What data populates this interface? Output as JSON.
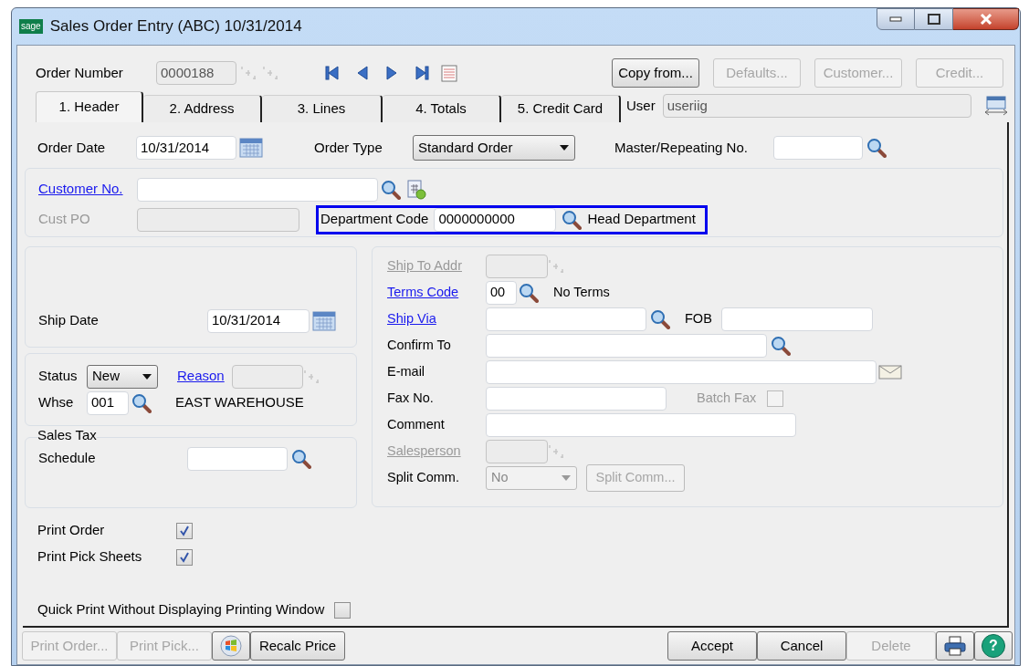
{
  "window": {
    "title": "Sales Order Entry (ABC) 10/31/2014",
    "logo": "sage"
  },
  "order_number": {
    "label": "Order Number",
    "value": "0000188",
    "disabled": true
  },
  "top_buttons": [
    {
      "label": "Copy from...",
      "disabled": false
    },
    {
      "label": "Defaults...",
      "disabled": true
    },
    {
      "label": "Customer...",
      "disabled": true
    },
    {
      "label": "Credit...",
      "disabled": true
    }
  ],
  "tabs": [
    {
      "label": "1. Header",
      "selected": true
    },
    {
      "label": "2. Address",
      "selected": false
    },
    {
      "label": "3. Lines",
      "selected": false
    },
    {
      "label": "4. Totals",
      "selected": false
    },
    {
      "label": "5. Credit Card",
      "selected": false
    }
  ],
  "user": {
    "label": "User",
    "value": "useriig"
  },
  "order_date": {
    "label": "Order Date",
    "value": "10/31/2014"
  },
  "order_type": {
    "label": "Order Type",
    "value": "Standard Order"
  },
  "master_repeating": {
    "label": "Master/Repeating No."
  },
  "customer_no": {
    "label": "Customer No.",
    "link": true
  },
  "cust_po": {
    "label": "Cust PO",
    "disabled": true
  },
  "department_code": {
    "label": "Department Code",
    "value": "0000000000",
    "description": "Head Department",
    "highlighted": true
  },
  "ship_date": {
    "label": "Ship Date",
    "value": "10/31/2014"
  },
  "status": {
    "label": "Status",
    "value": "New"
  },
  "reason": {
    "label": "Reason",
    "link": true
  },
  "whse": {
    "label": "Whse",
    "value": "001",
    "description": "EAST WAREHOUSE"
  },
  "sales_tax": {
    "title": "Sales Tax",
    "label": "Schedule"
  },
  "ship_to_addr": {
    "label": "Ship To Addr",
    "link": true,
    "disabled": true
  },
  "terms_code": {
    "label": "Terms Code",
    "link": true,
    "value": "00",
    "description": "No Terms"
  },
  "ship_via": {
    "label": "Ship Via",
    "link": true
  },
  "fob": {
    "label": "FOB"
  },
  "confirm_to": {
    "label": "Confirm To"
  },
  "email": {
    "label": "E-mail"
  },
  "fax_no": {
    "label": "Fax No."
  },
  "batch_fax": {
    "label": "Batch Fax",
    "checked": false,
    "disabled": true
  },
  "comment": {
    "label": "Comment"
  },
  "salesperson": {
    "label": "Salesperson",
    "link": true,
    "disabled": true
  },
  "split_comm": {
    "label": "Split Comm.",
    "value": "No",
    "button": "Split Comm...",
    "disabled": true
  },
  "print_options": [
    {
      "label": "Print Order",
      "checked": true
    },
    {
      "label": "Print Pick Sheets",
      "checked": true
    },
    {
      "label": "Quick Print Without Displaying Printing Window",
      "checked": false
    }
  ],
  "bottom_left_buttons": [
    {
      "kind": "text",
      "label": "Print Order...",
      "disabled": true
    },
    {
      "kind": "text",
      "label": "Print Pick...",
      "disabled": true
    },
    {
      "kind": "icon"
    },
    {
      "kind": "text",
      "label": "Recalc Price",
      "disabled": false
    }
  ],
  "bottom_right_buttons": [
    {
      "kind": "text",
      "label": "Accept",
      "disabled": false
    },
    {
      "kind": "text",
      "label": "Cancel",
      "disabled": false
    },
    {
      "kind": "text",
      "label": "Delete",
      "disabled": true
    },
    {
      "kind": "print"
    },
    {
      "kind": "help",
      "label": "?"
    }
  ]
}
